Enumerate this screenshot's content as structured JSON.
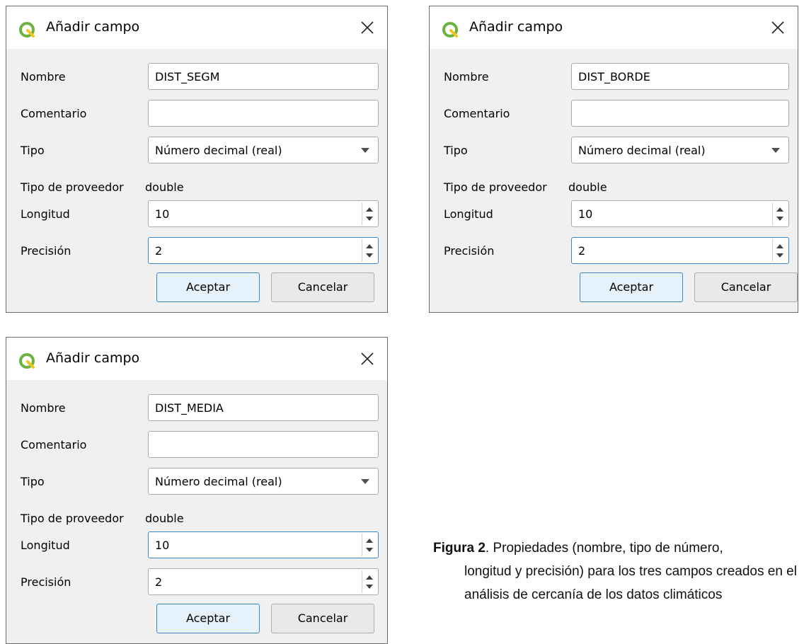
{
  "dialogs": [
    {
      "title": "Añadir campo",
      "labels": {
        "nombre": "Nombre",
        "comentario": "Comentario",
        "tipo": "Tipo",
        "tipo_proveedor": "Tipo de proveedor",
        "longitud": "Longitud",
        "precision": "Precisión"
      },
      "nombre": "DIST_SEGM",
      "comentario": "",
      "tipo": "Número decimal (real)",
      "tipo_proveedor": "double",
      "longitud": "10",
      "precision": "2",
      "focused_field": "precision",
      "buttons": {
        "ok": "Aceptar",
        "cancel": "Cancelar"
      }
    },
    {
      "title": "Añadir campo",
      "labels": {
        "nombre": "Nombre",
        "comentario": "Comentario",
        "tipo": "Tipo",
        "tipo_proveedor": "Tipo de proveedor",
        "longitud": "Longitud",
        "precision": "Precisión"
      },
      "nombre": "DIST_BORDE",
      "comentario": "",
      "tipo": "Número decimal (real)",
      "tipo_proveedor": "double",
      "longitud": "10",
      "precision": "2",
      "focused_field": "precision",
      "buttons": {
        "ok": "Aceptar",
        "cancel": "Cancelar"
      }
    },
    {
      "title": "Añadir campo",
      "labels": {
        "nombre": "Nombre",
        "comentario": "Comentario",
        "tipo": "Tipo",
        "tipo_proveedor": "Tipo de proveedor",
        "longitud": "Longitud",
        "precision": "Precisión"
      },
      "nombre": "DIST_MEDIA",
      "comentario": "",
      "tipo": "Número decimal (real)",
      "tipo_proveedor": "double",
      "longitud": "10",
      "precision": "2",
      "focused_field": "longitud",
      "buttons": {
        "ok": "Aceptar",
        "cancel": "Cancelar"
      }
    }
  ],
  "caption": {
    "label": "Figura 2",
    "text_line1": ". Propiedades (nombre, tipo de número,",
    "text_rest": "longitud y precisión) para los tres campos creados en el análisis de cercanía de los datos climáticos"
  },
  "colors": {
    "focus_border": "#3c84c9",
    "qgis_green": "#6ab33e"
  },
  "icons": {
    "app": "qgis-logo-icon",
    "close": "close-icon",
    "combo": "chevron-down-icon",
    "spin": "spin-arrows-icon"
  }
}
